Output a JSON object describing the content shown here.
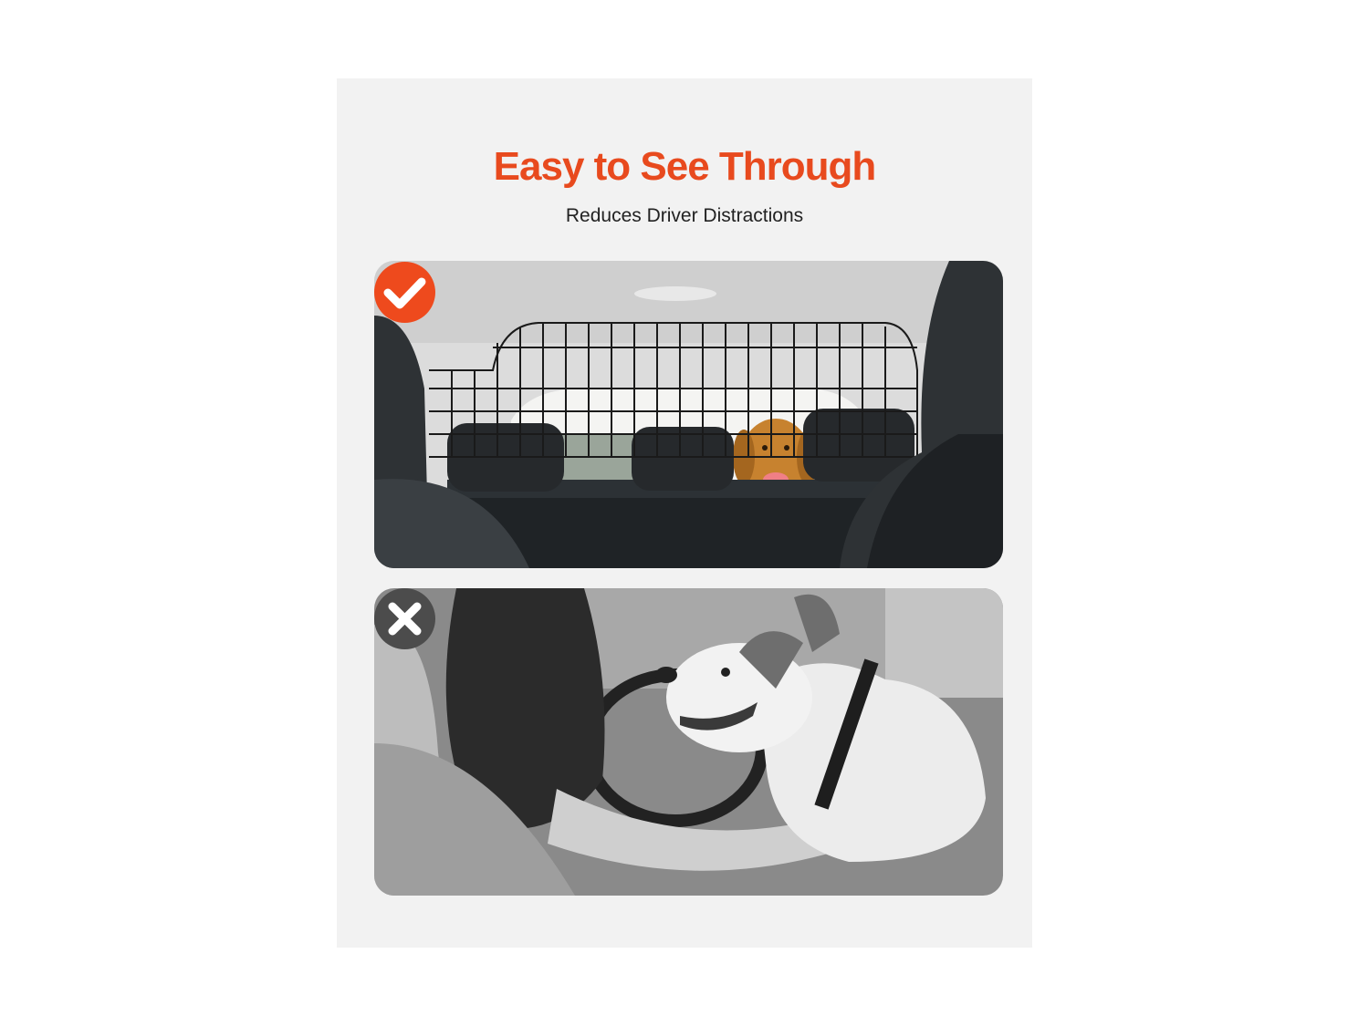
{
  "header": {
    "title": "Easy to See Through",
    "subtitle": "Reduces Driver Distractions"
  },
  "panels": {
    "good": {
      "badge_icon": "checkmark-icon",
      "badge_color": "#ee4a1d"
    },
    "bad": {
      "badge_icon": "x-mark-icon",
      "badge_color": "#4c4c4c"
    }
  },
  "colors": {
    "accent": "#e84a1e",
    "card_background": "#f2f2f2"
  }
}
